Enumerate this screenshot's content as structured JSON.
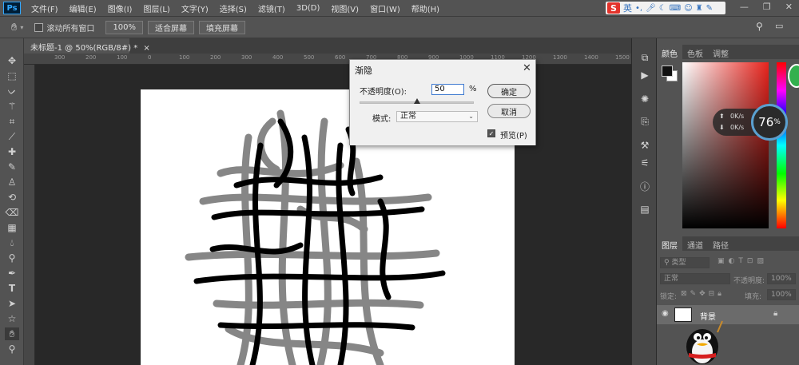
{
  "app": {
    "logo_text": "Ps"
  },
  "menu": [
    "文件(F)",
    "编辑(E)",
    "图像(I)",
    "图层(L)",
    "文字(Y)",
    "选择(S)",
    "滤镜(T)",
    "3D(D)",
    "视图(V)",
    "窗口(W)",
    "帮助(H)"
  ],
  "ime": {
    "logo": "S",
    "mode": "英"
  },
  "window_controls": {
    "minimize": "—",
    "restore": "❐",
    "close": "✕"
  },
  "options_bar": {
    "scroll_all_windows": "滚动所有窗口",
    "zoom_100": "100%",
    "fit_screen": "适合屏幕",
    "fill_screen": "填充屏幕"
  },
  "document_tab": {
    "title": "未标题-1 @ 50%(RGB/8#) *",
    "close": "×"
  },
  "ruler_ticks": [
    "300",
    "200",
    "100",
    "0",
    "100",
    "200",
    "300",
    "400",
    "500",
    "600",
    "700",
    "800",
    "900",
    "1000",
    "1100",
    "1200",
    "1300",
    "1400",
    "1500"
  ],
  "fade_dialog": {
    "title": "渐隐",
    "close": "✕",
    "opacity_label": "不透明度(O):",
    "opacity_value": "50",
    "opacity_unit": "%",
    "opacity_fraction": 0.5,
    "mode_label": "模式:",
    "mode_value": "正常",
    "ok": "确定",
    "cancel": "取消",
    "preview_label": "预览(P)",
    "preview_checked": true
  },
  "color_panel": {
    "tabs": [
      "颜色",
      "色板",
      "调整"
    ],
    "net_speed_up": "0K/s",
    "net_speed_down": "0K/s",
    "net_percent": "76",
    "net_percent_unit": "%"
  },
  "layers_panel": {
    "tabs": [
      "图层",
      "通道",
      "路径"
    ],
    "kind_filter": "类型",
    "blend_mode": "正常",
    "opacity_label": "不透明度:",
    "opacity_value": "100%",
    "lock_label": "锁定:",
    "fill_label": "填充:",
    "fill_value": "100%",
    "layer_name": "背景"
  },
  "colors": {
    "accent": "#31a8ff",
    "workspace": "#282828",
    "panel": "#535353"
  }
}
